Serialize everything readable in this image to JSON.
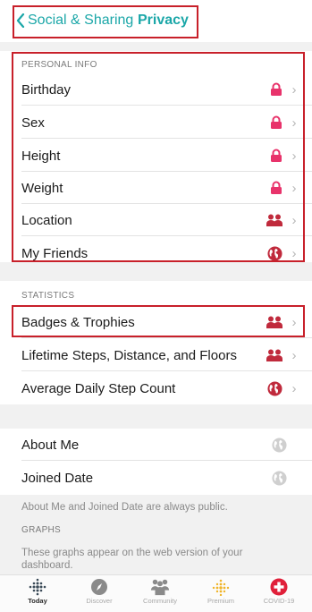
{
  "nav": {
    "back_label": "Social & Sharing",
    "title": "Privacy"
  },
  "personal_info": {
    "header": "PERSONAL INFO",
    "items": [
      {
        "label": "Birthday",
        "icon": "lock-icon"
      },
      {
        "label": "Sex",
        "icon": "lock-icon"
      },
      {
        "label": "Height",
        "icon": "lock-icon"
      },
      {
        "label": "Weight",
        "icon": "lock-icon"
      },
      {
        "label": "Location",
        "icon": "friends-icon"
      },
      {
        "label": "My Friends",
        "icon": "globe-icon"
      }
    ]
  },
  "statistics": {
    "header": "STATISTICS",
    "items": [
      {
        "label": "Badges & Trophies",
        "icon": "friends-icon"
      },
      {
        "label": "Lifetime Steps, Distance, and Floors",
        "icon": "friends-icon"
      },
      {
        "label": "Average Daily Step Count",
        "icon": "globe-icon"
      }
    ]
  },
  "public_info": {
    "items": [
      {
        "label": "About Me",
        "icon": "globe-icon"
      },
      {
        "label": "Joined Date",
        "icon": "globe-icon"
      }
    ],
    "note": "About Me and Joined Date are always public."
  },
  "graphs": {
    "header": "GRAPHS",
    "note": "These graphs appear on the web version of your dashboard."
  },
  "tabs": [
    {
      "label": "Today",
      "icon": "dots-grid-icon",
      "active": true
    },
    {
      "label": "Discover",
      "icon": "compass-icon",
      "active": false
    },
    {
      "label": "Community",
      "icon": "people-icon",
      "active": false
    },
    {
      "label": "Premium",
      "icon": "premium-dots-icon",
      "active": false
    },
    {
      "label": "COVID-19",
      "icon": "red-cross-icon",
      "active": false
    }
  ],
  "colors": {
    "accent": "#1ba7a8",
    "lock": "#e8336b",
    "friends": "#c02a3c",
    "highlight_box": "#c8202a",
    "globe_inactive": "#cfcfcf"
  }
}
